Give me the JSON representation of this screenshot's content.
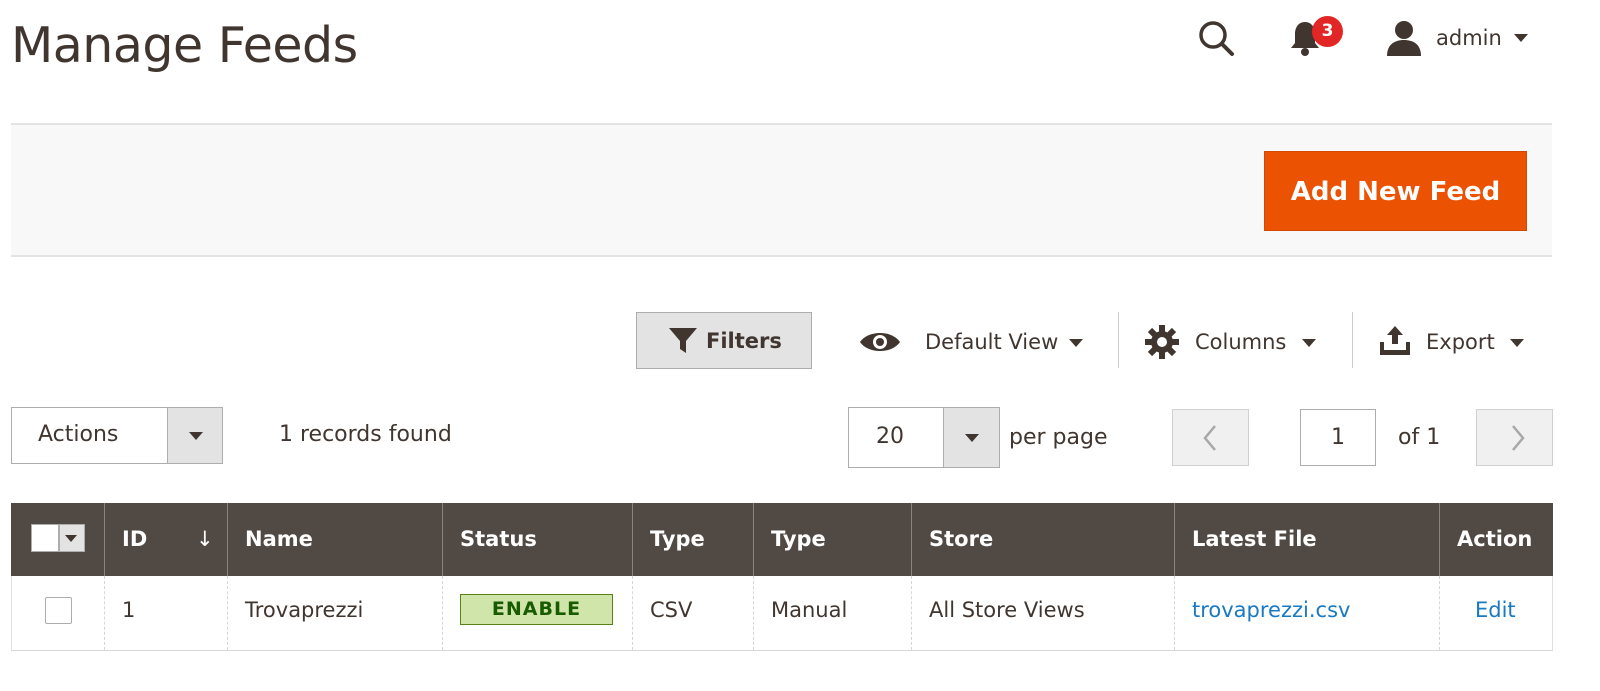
{
  "header": {
    "title": "Manage Feeds",
    "notifications_count": "3",
    "user_label": "admin"
  },
  "page_actions": {
    "add_button_label": "Add New Feed"
  },
  "toolbar": {
    "filters_label": "Filters",
    "view_label": "Default View",
    "columns_label": "Columns",
    "export_label": "Export"
  },
  "controls": {
    "actions_label": "Actions",
    "records_found": "1 records found",
    "per_page_value": "20",
    "per_page_label": "per page",
    "current_page": "1",
    "total_pages_label": "of 1"
  },
  "grid": {
    "columns": [
      "ID",
      "Name",
      "Status",
      "Type",
      "Type",
      "Store",
      "Latest File",
      "Action"
    ],
    "sort_indicator": "↓",
    "rows": [
      {
        "id": "1",
        "name": "Trovaprezzi",
        "status": "ENABLE",
        "type_format": "CSV",
        "type_mode": "Manual",
        "store": "All Store Views",
        "latest_file": "trovaprezzi.csv",
        "action": "Edit"
      }
    ]
  },
  "colors": {
    "brand_orange": "#eb5202",
    "header_dark": "#514943",
    "text_dark": "#41362f",
    "link_blue": "#1979c3",
    "badge_red": "#e22626",
    "status_enable_bg": "#d0e5a9",
    "status_enable_text": "#185b00"
  }
}
